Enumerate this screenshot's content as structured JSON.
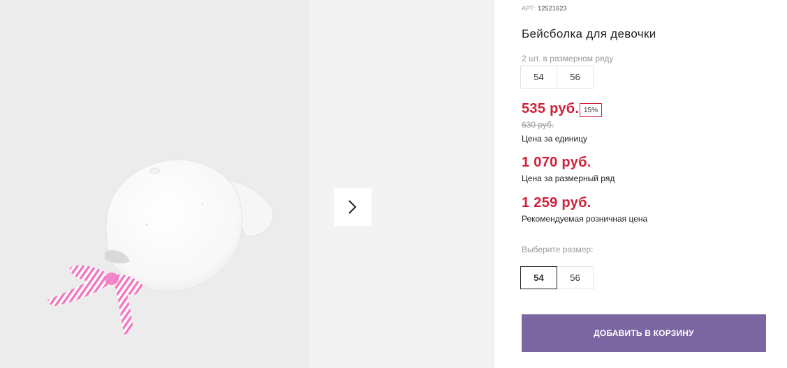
{
  "product": {
    "art_label": "АРТ:",
    "art_number": "12521623",
    "title": "Бейсболка для девочки",
    "size_row_label": "2 шт. в размерном ряду",
    "size_row": [
      "54",
      "56"
    ]
  },
  "prices": {
    "unit_price": "535 руб.",
    "discount": "15%",
    "old_price": "630 руб.",
    "unit_caption": "Цена за единицу",
    "row_price": "1 070 руб.",
    "row_caption": "Цена за размерный ряд",
    "rrp_price": "1 259 руб.",
    "rrp_caption": "Рекомендуемая розничная цена"
  },
  "size_select": {
    "label": "Выберите размер:",
    "options": [
      "54",
      "56"
    ],
    "selected": "54"
  },
  "cart": {
    "add_label": "Добавить в корзину"
  },
  "colors": {
    "accent": "#7b66a2",
    "price": "#d0203a",
    "bow_stripe": "#f279c2"
  },
  "gallery": {
    "next_icon": "chevron-right-icon"
  }
}
